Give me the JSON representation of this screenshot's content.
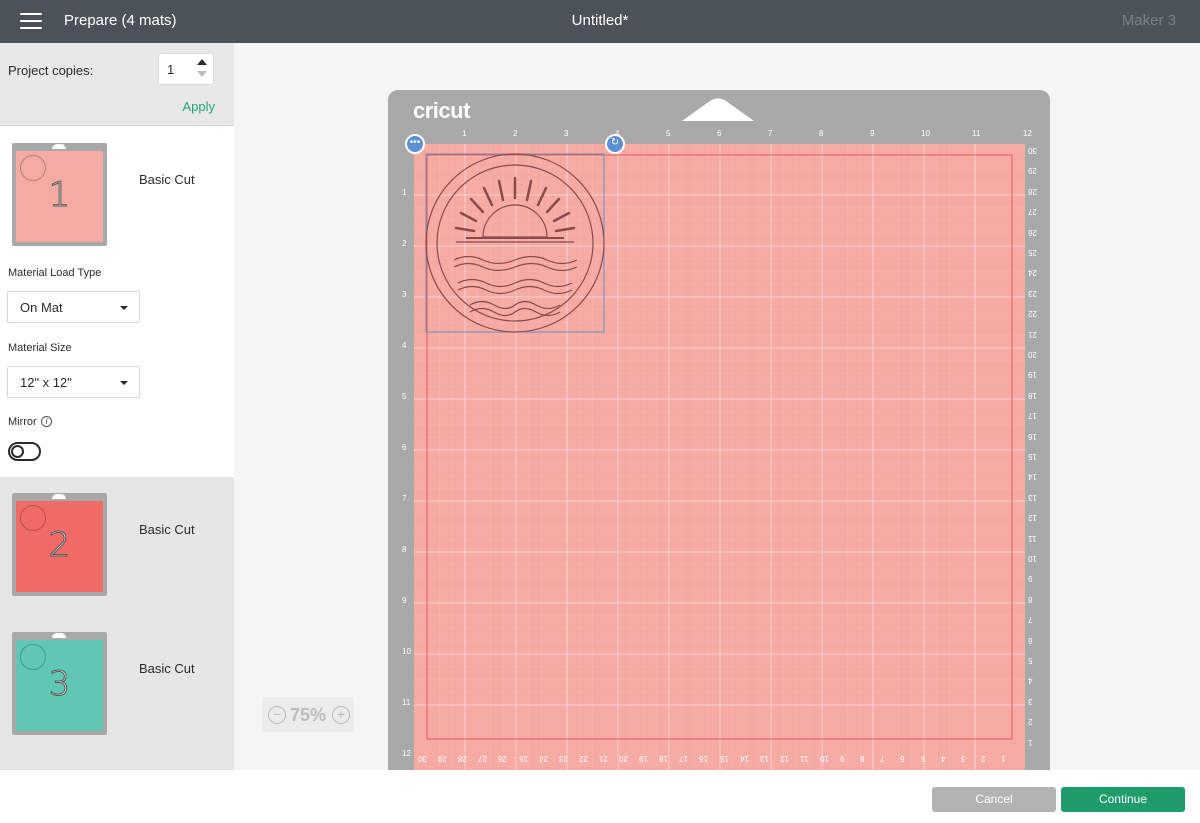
{
  "topbar": {
    "title": "Prepare (4 mats)",
    "document": "Untitled*",
    "machine": "Maker 3"
  },
  "sidebar": {
    "project_copies_label": "Project copies:",
    "project_copies_value": "1",
    "apply_label": "Apply",
    "mats": [
      {
        "number": "1",
        "label": "Basic Cut",
        "color": "#f6aaa4"
      },
      {
        "number": "2",
        "label": "Basic Cut",
        "color": "#f16b66"
      },
      {
        "number": "3",
        "label": "Basic Cut",
        "color": "#5fc7b4"
      }
    ],
    "material_load_type_label": "Material Load Type",
    "material_load_type_value": "On Mat",
    "material_size_label": "Material Size",
    "material_size_value": "12\" x 12\"",
    "mirror_label": "Mirror",
    "mirror_on": false
  },
  "mat": {
    "brand": "cricut",
    "color": "#f6aaa4",
    "ruler_top": [
      "1",
      "2",
      "3",
      "4",
      "5",
      "6",
      "7",
      "8",
      "9",
      "10",
      "11",
      "12"
    ],
    "ruler_left": [
      "1",
      "2",
      "3",
      "4",
      "5",
      "6",
      "7",
      "8",
      "9",
      "10",
      "11",
      "12"
    ],
    "ruler_right": [
      "30",
      "29",
      "28",
      "27",
      "26",
      "25",
      "24",
      "23",
      "22",
      "21",
      "20",
      "19",
      "18",
      "17",
      "16",
      "15",
      "14",
      "13",
      "12",
      "11",
      "10",
      "9",
      "8",
      "7",
      "6",
      "5",
      "4",
      "3",
      "2",
      "1"
    ],
    "ruler_bottom": [
      "30",
      "29",
      "28",
      "27",
      "26",
      "25",
      "24",
      "23",
      "22",
      "21",
      "20",
      "19",
      "18",
      "17",
      "16",
      "15",
      "14",
      "13",
      "12",
      "11",
      "10",
      "9",
      "8",
      "7",
      "6",
      "5",
      "4",
      "3",
      "2",
      "1"
    ]
  },
  "zoom": {
    "minus": "−",
    "value": "75%",
    "plus": "+"
  },
  "footer": {
    "cancel_label": "Cancel",
    "continue_label": "Continue"
  }
}
